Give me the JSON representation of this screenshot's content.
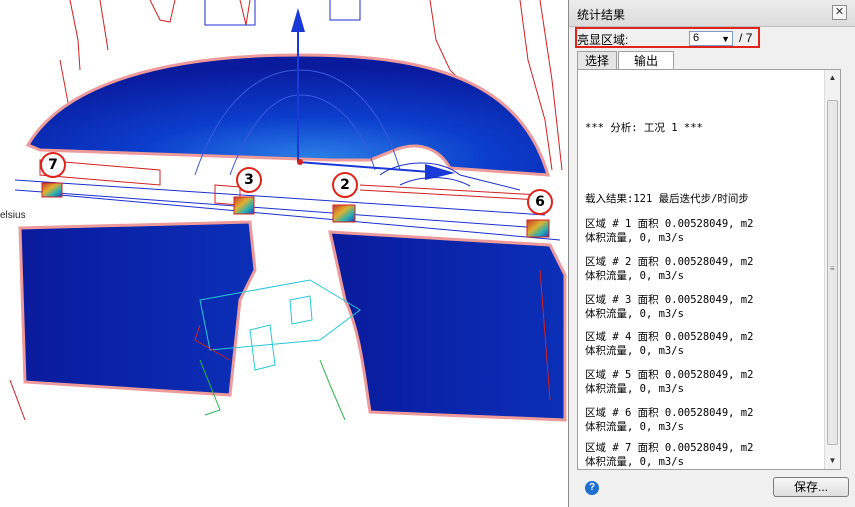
{
  "viewport": {
    "legend_fragment": "elsius",
    "callouts": [
      "7",
      "3",
      "2",
      "6"
    ]
  },
  "panel": {
    "title": "统计结果",
    "close_symbol": "✕",
    "highlight": {
      "label": "亮显区域:",
      "selected": "6",
      "separator": "/",
      "total": "7"
    },
    "tabs": {
      "select": "选择",
      "output": "输出"
    },
    "output": {
      "analysis_line": "*** 分析: 工况 1 ***",
      "load_line": "载入结果:121 最后迭代步/时间步",
      "regions": [
        {
          "line1": "区域 # 1 面积 0.00528049, m2",
          "line2": "体积流量, 0, m3/s"
        },
        {
          "line1": "区域 # 2 面积 0.00528049, m2",
          "line2": "体积流量, 0, m3/s"
        },
        {
          "line1": "区域 # 3 面积 0.00528049, m2",
          "line2": "体积流量, 0, m3/s"
        },
        {
          "line1": "区域 # 4 面积 0.00528049, m2",
          "line2": "体积流量, 0, m3/s"
        },
        {
          "line1": "区域 # 5 面积 0.00528049, m2",
          "line2": "体积流量, 0, m3/s"
        },
        {
          "line1": "区域 # 6 面积 0.00528049, m2",
          "line2": "体积流量, 0, m3/s"
        },
        {
          "line1": "区域 # 7 面积 0.00528049, m2",
          "line2": "体积流量, 0, m3/s"
        }
      ]
    },
    "help_symbol": "?",
    "save_label": "保存..."
  },
  "colors": {
    "highlight_red": "#e0241b",
    "mesh_blue": "#0a1fa8",
    "outline_red": "#d32020"
  },
  "icons": [
    "close-icon",
    "dropdown-arrow-icon",
    "scroll-up-icon",
    "scroll-down-icon",
    "help-icon"
  ]
}
